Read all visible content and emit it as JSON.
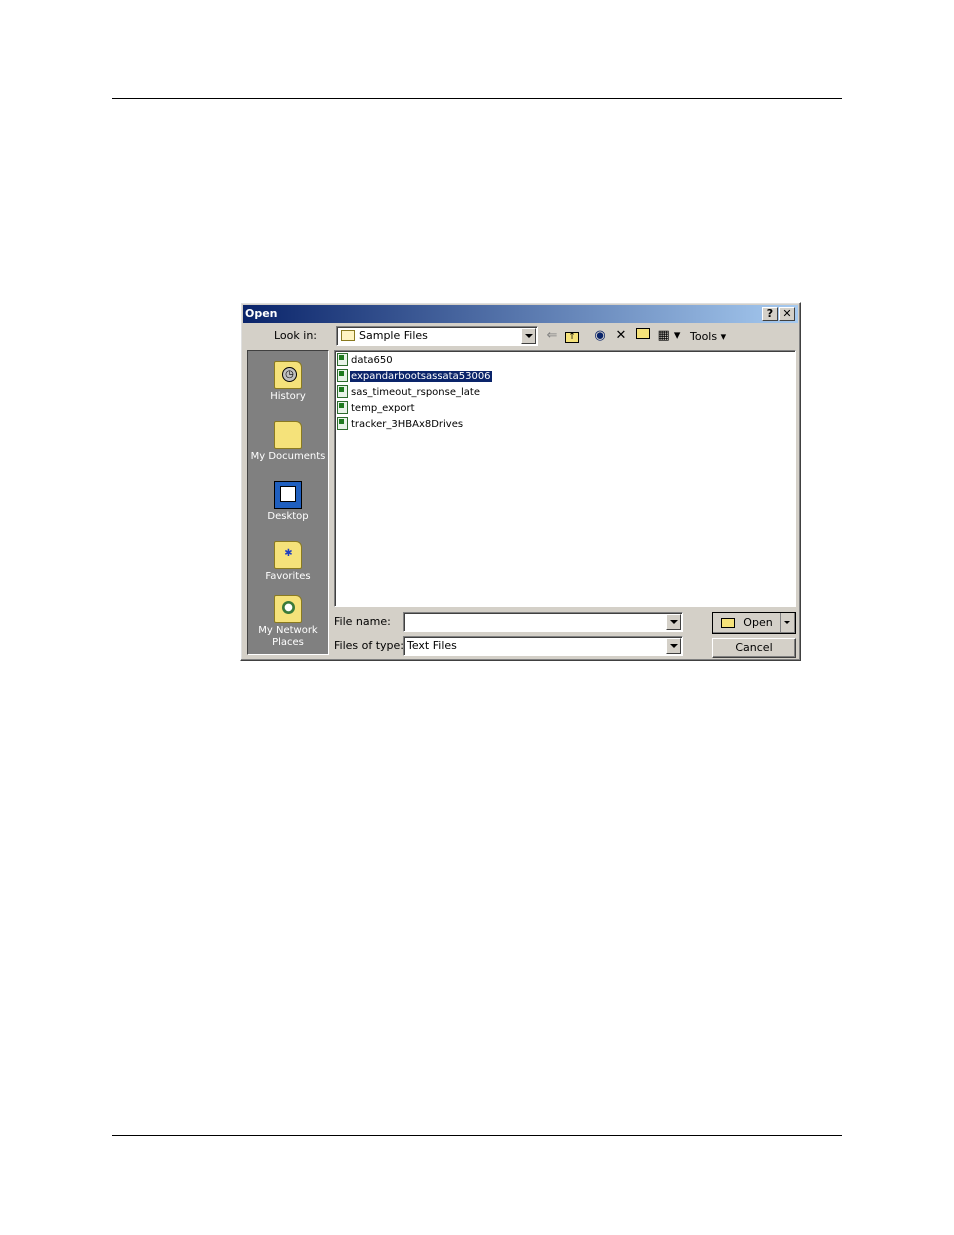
{
  "dialog": {
    "title": "Open",
    "help_glyph": "?",
    "close_glyph": "✕"
  },
  "look_in": {
    "label": "Look in:",
    "value": "Sample Files"
  },
  "toolbar": {
    "back_icon": "back-arrow-icon",
    "up_icon": "up-folder-icon",
    "search_icon": "search-web-icon",
    "delete_icon": "delete-icon",
    "new_folder_icon": "new-folder-icon",
    "views_icon": "views-icon",
    "tools_label": "Tools"
  },
  "places": [
    {
      "label": "History",
      "icon": "history-icon"
    },
    {
      "label": "My Documents",
      "icon": "my-documents-icon"
    },
    {
      "label": "Desktop",
      "icon": "desktop-icon"
    },
    {
      "label": "Favorites",
      "icon": "favorites-icon"
    },
    {
      "label": "My Network Places",
      "icon": "network-places-icon"
    }
  ],
  "files": [
    {
      "name": "data650",
      "selected": false
    },
    {
      "name": "expandarbootsassata53006",
      "selected": true
    },
    {
      "name": "sas_timeout_rsponse_late",
      "selected": false
    },
    {
      "name": "temp_export",
      "selected": false
    },
    {
      "name": "tracker_3HBAx8Drives",
      "selected": false
    }
  ],
  "file_name": {
    "label": "File name:",
    "value": ""
  },
  "file_type": {
    "label": "Files of type:",
    "value": "Text Files"
  },
  "buttons": {
    "open_label": "Open",
    "cancel_label": "Cancel"
  }
}
